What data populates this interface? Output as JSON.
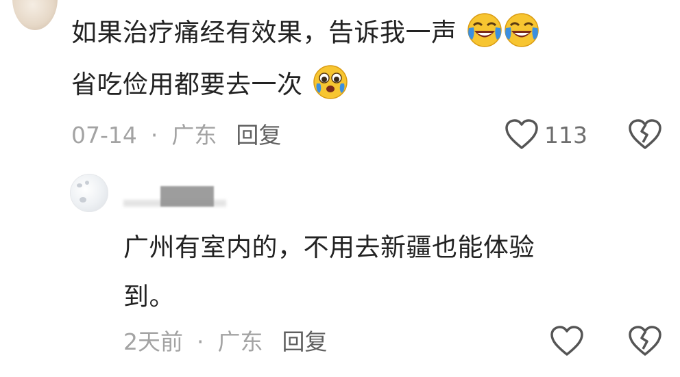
{
  "comments": [
    {
      "text_line1": "如果治疗痛经有效果，告诉我一声",
      "text_line2": "省吃俭用都要去一次",
      "date": "07-14",
      "location": "广东",
      "reply_label": "回复",
      "like_count": "113",
      "emojis": [
        "laughing-crying-emoji",
        "laughing-crying-emoji",
        "pleading-emoji"
      ]
    },
    {
      "username": "",
      "text_line1": "广州有室内的，不用去新疆也能体验",
      "text_line2": "到。",
      "date": "2天前",
      "location": "广东",
      "reply_label": "回复",
      "like_count": ""
    }
  ],
  "separator": "·",
  "colors": {
    "text": "#222222",
    "meta": "#a3a3a3",
    "icon": "#555555",
    "emoji_face": "#f7c531",
    "emoji_tears": "#3b8fe0"
  }
}
